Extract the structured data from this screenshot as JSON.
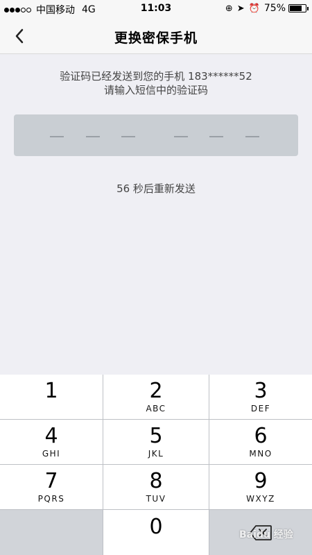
{
  "status": {
    "carrier": "中国移动",
    "network": "4G",
    "time": "11:03",
    "battery_text": "75%",
    "battery_level": 0.75
  },
  "nav": {
    "title": "更换密保手机"
  },
  "message": {
    "line1": "验证码已经发送到您的手机 183******52",
    "line2": "请输入短信中的验证码"
  },
  "resend_text": "56 秒后重新发送",
  "keypad": {
    "k1": {
      "num": "1",
      "letters": ""
    },
    "k2": {
      "num": "2",
      "letters": "ABC"
    },
    "k3": {
      "num": "3",
      "letters": "DEF"
    },
    "k4": {
      "num": "4",
      "letters": "GHI"
    },
    "k5": {
      "num": "5",
      "letters": "JKL"
    },
    "k6": {
      "num": "6",
      "letters": "MNO"
    },
    "k7": {
      "num": "7",
      "letters": "PQRS"
    },
    "k8": {
      "num": "8",
      "letters": "TUV"
    },
    "k9": {
      "num": "9",
      "letters": "WXYZ"
    },
    "k0": {
      "num": "0",
      "letters": ""
    }
  },
  "icons": {
    "back": "chevron-left-icon",
    "delete": "backspace-icon"
  },
  "watermark": "Baidu 经验"
}
